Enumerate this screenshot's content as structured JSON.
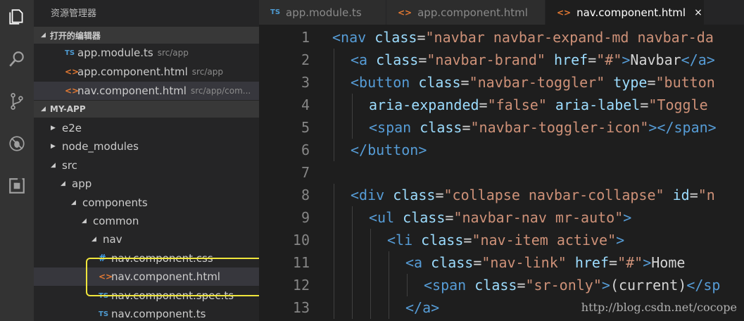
{
  "activity": {
    "items": [
      "explorer-icon",
      "search-icon",
      "source-control-icon",
      "debug-icon",
      "extensions-icon"
    ]
  },
  "sidebar": {
    "title": "资源管理器",
    "open_editors": {
      "header": "打开的编辑器",
      "items": [
        {
          "badge": "TS",
          "name": "app.module.ts",
          "path": "src/app"
        },
        {
          "badge": "<>",
          "name": "app.component.html",
          "path": "src/app"
        },
        {
          "badge": "<>",
          "name": "nav.component.html",
          "path": "src/app/com..."
        }
      ]
    },
    "project": {
      "header": "MY-APP",
      "tree": [
        {
          "arrow": "▶",
          "name": "e2e"
        },
        {
          "arrow": "▶",
          "name": "node_modules"
        },
        {
          "arrow": "◢",
          "name": "src"
        },
        {
          "arrow": "◢",
          "name": "app"
        },
        {
          "arrow": "◢",
          "name": "components"
        },
        {
          "arrow": "◢",
          "name": "common"
        },
        {
          "arrow": "◢",
          "name": "nav"
        },
        {
          "badge": "#",
          "name": "nav.component.css"
        },
        {
          "badge": "<>",
          "name": "nav.component.html"
        },
        {
          "badge": "TS",
          "name": "nav.component.spec.ts"
        },
        {
          "badge": "TS",
          "name": "nav.component.ts"
        }
      ]
    }
  },
  "tabs": [
    {
      "badge": "TS",
      "label": "app.module.ts"
    },
    {
      "badge": "<>",
      "label": "app.component.html"
    },
    {
      "badge": "<>",
      "label": "nav.component.html",
      "close": "×"
    }
  ],
  "editor": {
    "line_numbers": [
      "1",
      "2",
      "3",
      "4",
      "5",
      "6",
      "7",
      "8",
      "9",
      "10",
      "11",
      "12",
      "13"
    ],
    "lines": [
      [
        [
          "tag",
          "<nav "
        ],
        [
          "attr",
          "class"
        ],
        [
          "txt",
          "="
        ],
        [
          "str",
          "\"navbar navbar-expand-md navbar-da"
        ]
      ],
      [
        [
          "tag",
          "<a "
        ],
        [
          "attr",
          "class"
        ],
        [
          "txt",
          "="
        ],
        [
          "str",
          "\"navbar-brand\" "
        ],
        [
          "attr",
          "href"
        ],
        [
          "txt",
          "="
        ],
        [
          "str",
          "\"#\""
        ],
        [
          "tag",
          ">"
        ],
        [
          "txt",
          "Navbar"
        ],
        [
          "tag",
          "</a>"
        ]
      ],
      [
        [
          "tag",
          "<button "
        ],
        [
          "attr",
          "class"
        ],
        [
          "txt",
          "="
        ],
        [
          "str",
          "\"navbar-toggler\" "
        ],
        [
          "attr",
          "type"
        ],
        [
          "txt",
          "="
        ],
        [
          "str",
          "\"button"
        ]
      ],
      [
        [
          "attr",
          "aria-expanded"
        ],
        [
          "txt",
          "="
        ],
        [
          "str",
          "\"false\" "
        ],
        [
          "attr",
          "aria-label"
        ],
        [
          "txt",
          "="
        ],
        [
          "str",
          "\"Toggle"
        ]
      ],
      [
        [
          "tag",
          "<span "
        ],
        [
          "attr",
          "class"
        ],
        [
          "txt",
          "="
        ],
        [
          "str",
          "\"navbar-toggler-icon\""
        ],
        [
          "tag",
          "></span>"
        ]
      ],
      [
        [
          "tag",
          "</button>"
        ]
      ],
      [],
      [
        [
          "tag",
          "<div "
        ],
        [
          "attr",
          "class"
        ],
        [
          "txt",
          "="
        ],
        [
          "str",
          "\"collapse navbar-collapse\" "
        ],
        [
          "attr",
          "id"
        ],
        [
          "txt",
          "="
        ],
        [
          "str",
          "\"n"
        ]
      ],
      [
        [
          "tag",
          "<ul "
        ],
        [
          "attr",
          "class"
        ],
        [
          "txt",
          "="
        ],
        [
          "str",
          "\"navbar-nav mr-auto\""
        ],
        [
          "tag",
          ">"
        ]
      ],
      [
        [
          "tag",
          "<li "
        ],
        [
          "attr",
          "class"
        ],
        [
          "txt",
          "="
        ],
        [
          "str",
          "\"nav-item active\""
        ],
        [
          "tag",
          ">"
        ]
      ],
      [
        [
          "tag",
          "<a "
        ],
        [
          "attr",
          "class"
        ],
        [
          "txt",
          "="
        ],
        [
          "str",
          "\"nav-link\" "
        ],
        [
          "attr",
          "href"
        ],
        [
          "txt",
          "="
        ],
        [
          "str",
          "\"#\""
        ],
        [
          "tag",
          ">"
        ],
        [
          "txt",
          "Home"
        ]
      ],
      [
        [
          "tag",
          "<span "
        ],
        [
          "attr",
          "class"
        ],
        [
          "txt",
          "="
        ],
        [
          "str",
          "\"sr-only\""
        ],
        [
          "tag",
          ">"
        ],
        [
          "txt",
          "(current)"
        ],
        [
          "tag",
          "</sp"
        ]
      ],
      [
        [
          "tag",
          "</a>"
        ]
      ]
    ],
    "indents": [
      0,
      1,
      1,
      2,
      2,
      1,
      0,
      1,
      2,
      3,
      4,
      5,
      4
    ]
  },
  "watermark": "http://blog.csdn.net/cocope"
}
